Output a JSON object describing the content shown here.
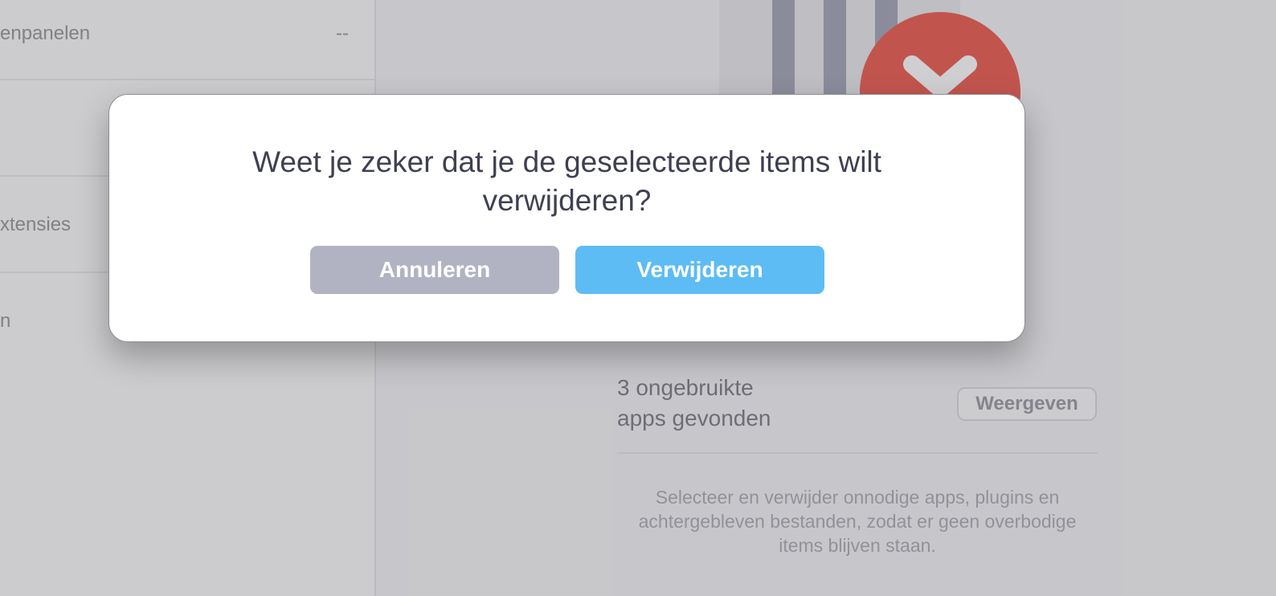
{
  "sidebar": {
    "rows": [
      {
        "label": "enpanelen",
        "value": "--"
      },
      {
        "label": "",
        "value": ""
      },
      {
        "label": "xtensies",
        "value": ""
      },
      {
        "label": "n",
        "value": ""
      }
    ]
  },
  "main": {
    "result_line1": "3 ongebruikte",
    "result_line2": "apps gevonden",
    "show_button": "Weergeven",
    "description": "Selecteer en verwijder onnodige apps, plugins en achtergebleven bestanden, zodat er geen overbodige items blijven staan.",
    "colors": {
      "trash_badge": "#ea4a3c",
      "trash_stripes": "#9a9caf"
    }
  },
  "dialog": {
    "title_line1": "Weet je zeker dat je de geselecteerde items wilt",
    "title_line2": "verwijderen?",
    "cancel_label": "Annuleren",
    "delete_label": "Verwijderen",
    "colors": {
      "cancel": "#b2b3c2",
      "delete": "#5dbcf4"
    }
  }
}
